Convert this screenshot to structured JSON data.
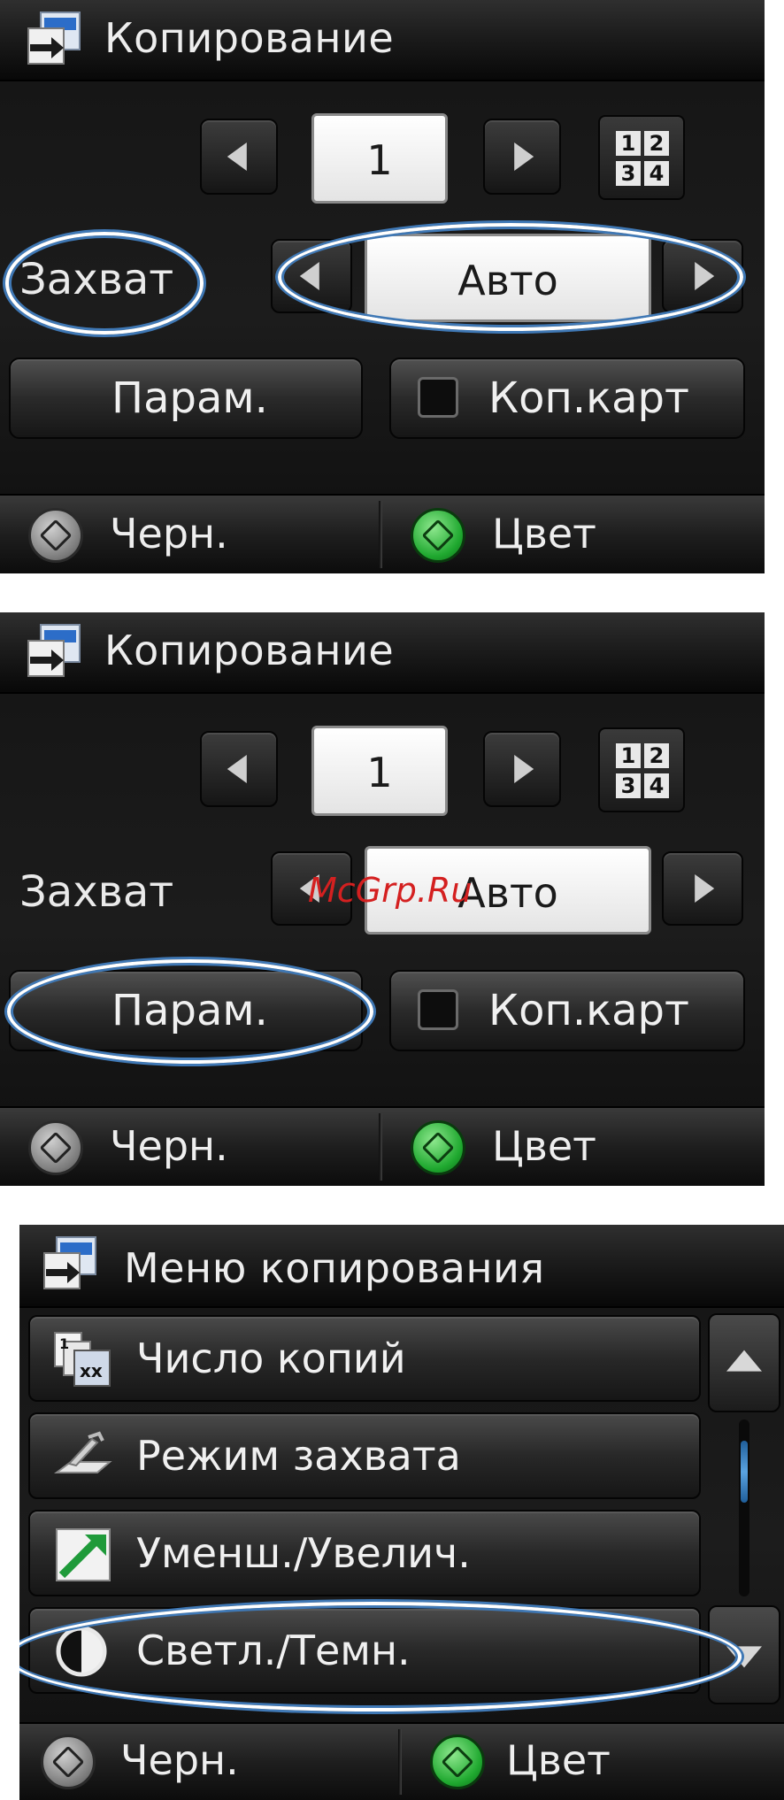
{
  "screen1": {
    "title": "Копирование",
    "copies_value": "1",
    "capture_label": "Захват",
    "capture_value": "Авто",
    "options_button": "Парам.",
    "collate_button": "Коп.карт",
    "footer_black": "Черн.",
    "footer_color": "Цвет"
  },
  "screen2": {
    "title": "Копирование",
    "copies_value": "1",
    "capture_label": "Захват",
    "capture_value": "Авто",
    "options_button": "Парам.",
    "collate_button": "Коп.карт",
    "footer_black": "Черн.",
    "footer_color": "Цвет",
    "watermark": "McGrp.Ru"
  },
  "screen3": {
    "title": "Меню копирования",
    "items": [
      {
        "label": "Число копий",
        "icon": "copy-count-icon"
      },
      {
        "label": "Режим захвата",
        "icon": "scanner-lid-icon"
      },
      {
        "label": "Уменш./Увелич.",
        "icon": "resize-arrow-icon"
      },
      {
        "label": "Светл./Темн.",
        "icon": "contrast-icon"
      }
    ],
    "footer_black": "Черн.",
    "footer_color": "Цвет"
  },
  "grid_digits": [
    "1",
    "2",
    "3",
    "4"
  ],
  "copy_count_badge": {
    "top": "1",
    "bottom": "xx"
  },
  "colors": {
    "highlight_oval": "#3f78b5",
    "start_green": "#1fa82f",
    "watermark": "#d42020"
  }
}
